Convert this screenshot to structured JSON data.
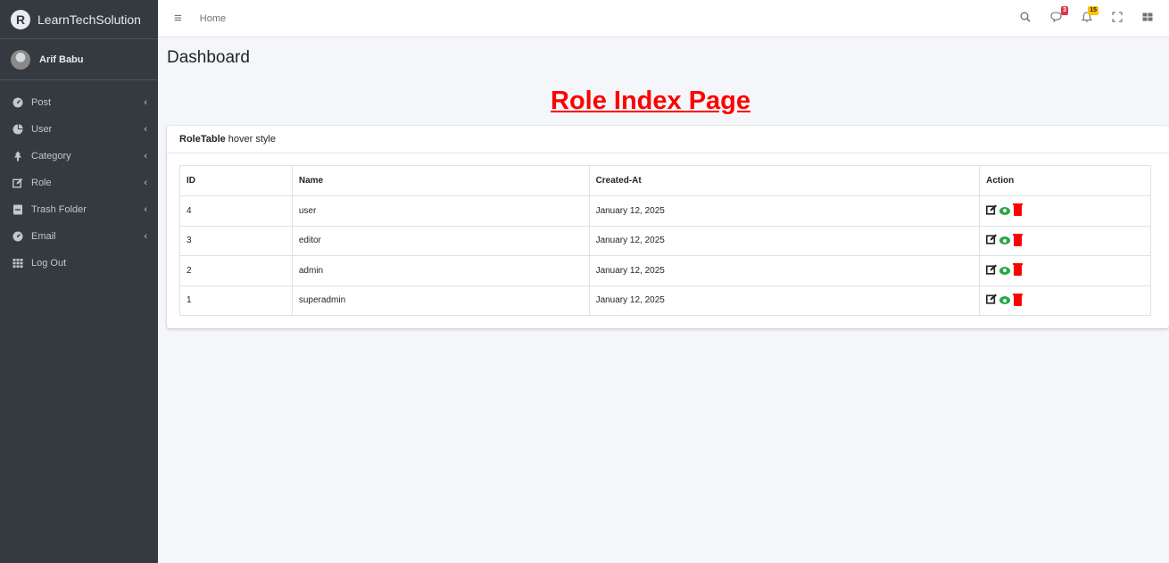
{
  "brand": {
    "logo_letter": "R",
    "name": "LearnTechSolution"
  },
  "user": {
    "name": "Arif Babu"
  },
  "sidebar": {
    "items": [
      {
        "label": "Post",
        "icon": "tachometer-icon",
        "has_submenu": true
      },
      {
        "label": "User",
        "icon": "pie-chart-icon",
        "has_submenu": true
      },
      {
        "label": "Category",
        "icon": "tree-icon",
        "has_submenu": true
      },
      {
        "label": "Role",
        "icon": "edit-icon",
        "has_submenu": true
      },
      {
        "label": "Trash Folder",
        "icon": "trash-folder-icon",
        "has_submenu": true
      },
      {
        "label": "Email",
        "icon": "tachometer-icon",
        "has_submenu": true
      },
      {
        "label": "Log Out",
        "icon": "grid-icon",
        "has_submenu": false
      }
    ]
  },
  "header": {
    "home_label": "Home",
    "messages_badge": "3",
    "notifications_badge": "15"
  },
  "page": {
    "title": "Dashboard",
    "index_title": "Role Index Page"
  },
  "card": {
    "title_bold": "RoleTable",
    "title_rest": "hover style"
  },
  "table": {
    "headers": [
      "ID",
      "Name",
      "Created-At",
      "Action"
    ],
    "rows": [
      {
        "id": "4",
        "name": "user",
        "created_at": "January 12, 2025"
      },
      {
        "id": "3",
        "name": "editor",
        "created_at": "January 12, 2025"
      },
      {
        "id": "2",
        "name": "admin",
        "created_at": "January 12, 2025"
      },
      {
        "id": "1",
        "name": "superadmin",
        "created_at": "January 12, 2025"
      }
    ]
  },
  "colors": {
    "sidebar_bg": "#343a40",
    "index_title": "#ff0000",
    "view_icon": "#28a745",
    "delete_icon": "#ff0000"
  }
}
